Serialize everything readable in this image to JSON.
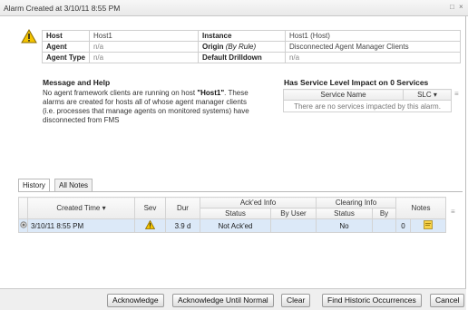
{
  "window": {
    "title": "Alarm Created at 3/10/11 8:55 PM",
    "restore_glyph": "□",
    "close_glyph": "×"
  },
  "properties": {
    "rows": [
      {
        "k1": "Host",
        "v1": "Host1",
        "k2": "Instance",
        "v2": "Host1 (Host)"
      },
      {
        "k1": "Agent",
        "v1": "n/a",
        "k2": "Origin",
        "k2_suffix": "(By Rule)",
        "v2": "Disconnected Agent Manager Clients"
      },
      {
        "k1": "Agent Type",
        "v1": "n/a",
        "k2": "Default Drilldown",
        "v2": "n/a"
      }
    ]
  },
  "message": {
    "title": "Message and Help",
    "line1": "No agent framework clients are running on host",
    "host": "\"Host1\"",
    "line2": ". These alarms are created for hosts all of whose agent manager clients (i.e. processes that manage agents on monitored systems) have disconnected from FMS"
  },
  "service_impact": {
    "title_prefix": "Has Service Level Impact on",
    "count": "0",
    "title_suffix": "Services",
    "col_name": "Service Name",
    "col_slc": "SLC ▾",
    "empty_text": "There are no services impacted by this alarm."
  },
  "tabs": [
    {
      "label": "History"
    },
    {
      "label": "All Notes"
    }
  ],
  "history": {
    "group_acked": "Ack'ed Info",
    "group_clearing": "Clearing Info",
    "col_created": "Created Time ▾",
    "col_sev": "Sev",
    "col_dur": "Dur",
    "col_status": "Status",
    "col_byuser": "By User",
    "col_clear_status": "Status",
    "col_by": "By",
    "col_notes": "Notes",
    "row": {
      "created": "3/10/11 8:55 PM",
      "dur": "3.9 d",
      "ack_status": "Not Ack'ed",
      "ack_by": "",
      "clear_status": "No",
      "clear_by": "",
      "notes_count": "0"
    }
  },
  "buttons": {
    "acknowledge": "Acknowledge",
    "ack_until_normal": "Acknowledge Until Normal",
    "clear": "Clear",
    "find_historic": "Find Historic Occurrences",
    "cancel": "Cancel"
  },
  "colors": {
    "selected_row": "#dce9f8",
    "warning": "#f2c200"
  }
}
